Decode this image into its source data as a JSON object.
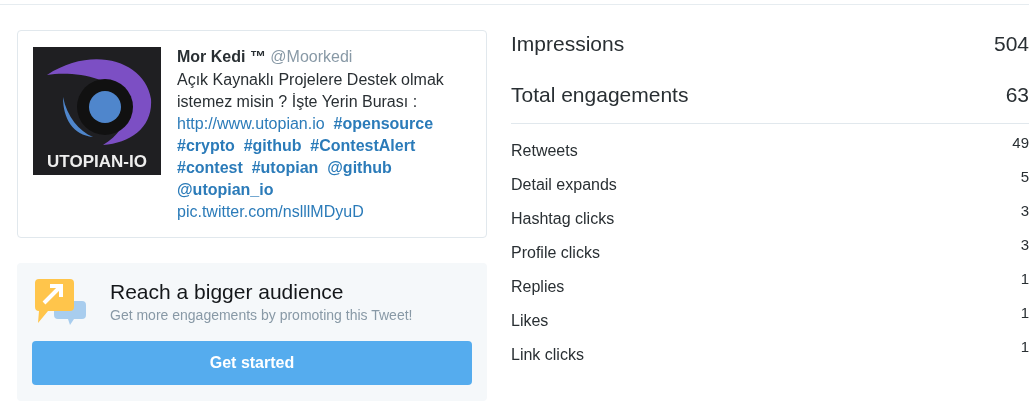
{
  "tweet": {
    "avatar": {
      "logo_text": "UTOPIAN-IO"
    },
    "name": "Mor Kedi ™",
    "handle": "@Moorkedi",
    "lines": [
      [
        {
          "kind": "text",
          "text": "Açık Kaynaklı Projelere Destek olmak"
        }
      ],
      [
        {
          "kind": "text",
          "text": "istemez misin ? İşte Yerin Burası :"
        }
      ],
      [
        {
          "kind": "url",
          "text": "http://www.utopian.io"
        },
        {
          "kind": "hashtag",
          "text": "#opensource"
        }
      ],
      [
        {
          "kind": "hashtag",
          "text": "#crypto"
        },
        {
          "kind": "hashtag",
          "text": "#github"
        },
        {
          "kind": "hashtag",
          "text": "#ContestAlert"
        }
      ],
      [
        {
          "kind": "hashtag",
          "text": "#contest"
        },
        {
          "kind": "hashtag",
          "text": "#utopian"
        },
        {
          "kind": "mention",
          "text": "@github"
        }
      ],
      [
        {
          "kind": "mention",
          "text": "@utopian_io"
        }
      ],
      [
        {
          "kind": "url",
          "text": "pic.twitter.com/nslllMDyuD"
        }
      ]
    ]
  },
  "promo": {
    "title": "Reach a bigger audience",
    "subtitle": "Get more engagements by promoting this Tweet!",
    "button": "Get started"
  },
  "metrics": {
    "primary": [
      {
        "label": "Impressions",
        "value": "504"
      },
      {
        "label": "Total engagements",
        "value": "63"
      }
    ],
    "details": [
      {
        "label": "Retweets",
        "value": "49"
      },
      {
        "label": "Detail expands",
        "value": "5"
      },
      {
        "label": "Hashtag clicks",
        "value": "3"
      },
      {
        "label": "Profile clicks",
        "value": "3"
      },
      {
        "label": "Replies",
        "value": "1"
      },
      {
        "label": "Likes",
        "value": "1"
      },
      {
        "label": "Link clicks",
        "value": "1"
      }
    ]
  }
}
